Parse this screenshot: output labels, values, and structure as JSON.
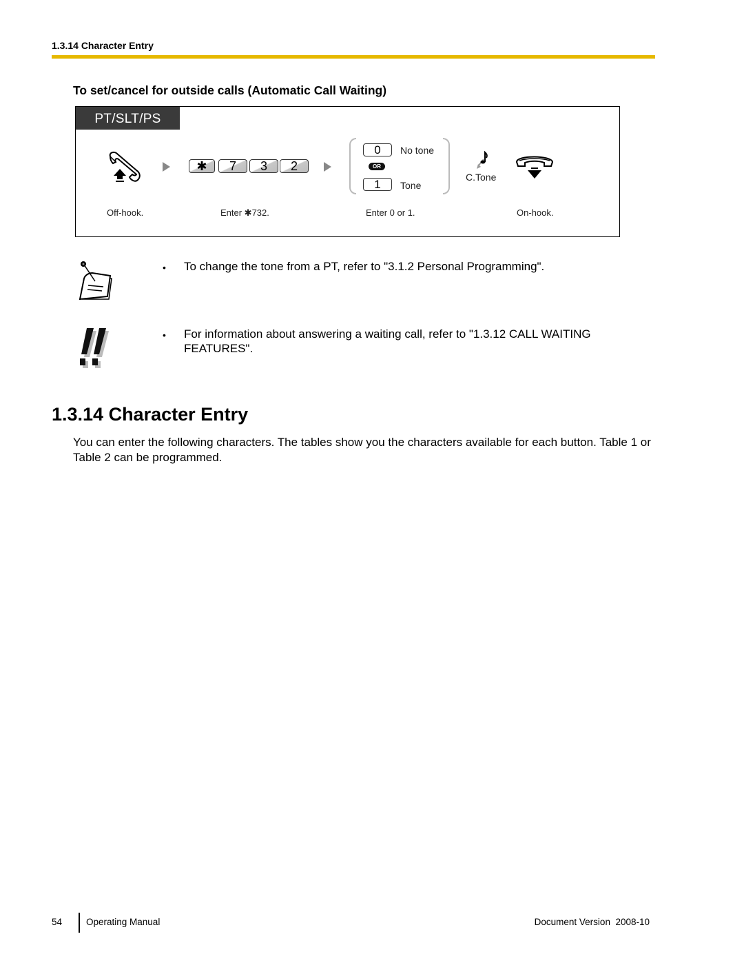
{
  "header": {
    "running_head": "1.3.14 Character Entry",
    "rule_color": "#e6b800"
  },
  "procedure": {
    "title": "To set/cancel for outside calls (Automatic Call Waiting)",
    "device_tab": "PT/SLT/PS",
    "steps": [
      {
        "icon": "off-hook-icon",
        "caption": "Off-hook."
      },
      {
        "icon": "keypad-keys",
        "keys": [
          "✱",
          "7",
          "3",
          "2"
        ],
        "caption": "Enter ✱732."
      },
      {
        "icon": "choice",
        "options": [
          {
            "key": "0",
            "label": "No tone"
          },
          {
            "key": "1",
            "label": "Tone"
          }
        ],
        "or_label": "OR",
        "caption": "Enter 0 or 1."
      },
      {
        "icon": "confirmation-tone-icon",
        "label": "C.Tone"
      },
      {
        "icon": "on-hook-icon",
        "caption": "On-hook."
      }
    ]
  },
  "notes": [
    {
      "icon": "memo-note-icon",
      "text": "To change the tone from a PT, refer to \"3.1.2  Personal Programming\"."
    },
    {
      "icon": "important-exclamation-icon",
      "text": "For information about answering a waiting call, refer to \"1.3.12  CALL WAITING FEATURES\"."
    }
  ],
  "bullet": "•",
  "section": {
    "heading": "1.3.14  Character Entry",
    "body": "You can enter the following characters. The tables show you the characters available for each button. Table 1 or Table 2 can be programmed."
  },
  "footer": {
    "page_number": "54",
    "manual": "Operating Manual",
    "version": "Document Version  2008-10"
  }
}
